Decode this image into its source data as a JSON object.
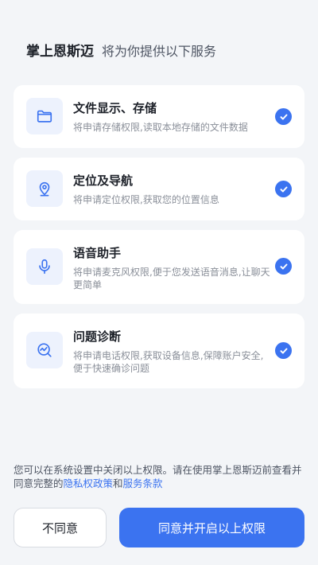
{
  "header": {
    "app_name": "掌上恩斯迈",
    "subtitle": "将为你提供以下服务"
  },
  "permissions": [
    {
      "title": "文件显示、存储",
      "desc": "将申请存储权限,读取本地存储的文件数据",
      "icon": "folder-icon",
      "checked": true
    },
    {
      "title": "定位及导航",
      "desc": "将申请定位权限,获取您的位置信息",
      "icon": "location-pin-icon",
      "checked": true
    },
    {
      "title": "语音助手",
      "desc": "将申请麦克风权限,便于您发送语音消息,让聊天更简单",
      "icon": "microphone-icon",
      "checked": true
    },
    {
      "title": "问题诊断",
      "desc": "将申请电话权限,获取设备信息,保障账户安全,便于快速确诊问题",
      "icon": "diagnosis-icon",
      "checked": true
    }
  ],
  "footer": {
    "text_before": "您可以在系统设置中关闭以上权限。请在使用掌上恩斯迈前查看并同意完整的",
    "privacy_link": "隐私权政策",
    "and": "和",
    "terms_link": "服务条款"
  },
  "buttons": {
    "disagree": "不同意",
    "agree": "同意并开启以上权限"
  },
  "colors": {
    "accent": "#3b73f0",
    "background": "#f3f5f8",
    "icon_bg": "#edf2fd"
  }
}
